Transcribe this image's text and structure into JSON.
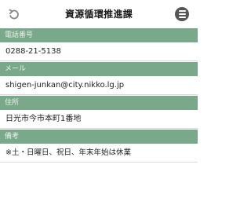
{
  "header": {
    "title": "資源循環推進課",
    "back_icon": "undo-icon",
    "menu_icon": "menu-icon"
  },
  "sections": [
    {
      "label": "電話番号",
      "value": "0288-21-5138"
    },
    {
      "label": "メール",
      "value": "shigen-junkan@city.nikko.lg.jp"
    },
    {
      "label": "住所",
      "value": "日光市今市本町1番地"
    },
    {
      "label": "備考",
      "value": "※土・日曜日、祝日、年末年始は休業"
    }
  ],
  "colors": {
    "section_header_bg": "#7aa88a",
    "menu_button_bg": "#555555"
  }
}
